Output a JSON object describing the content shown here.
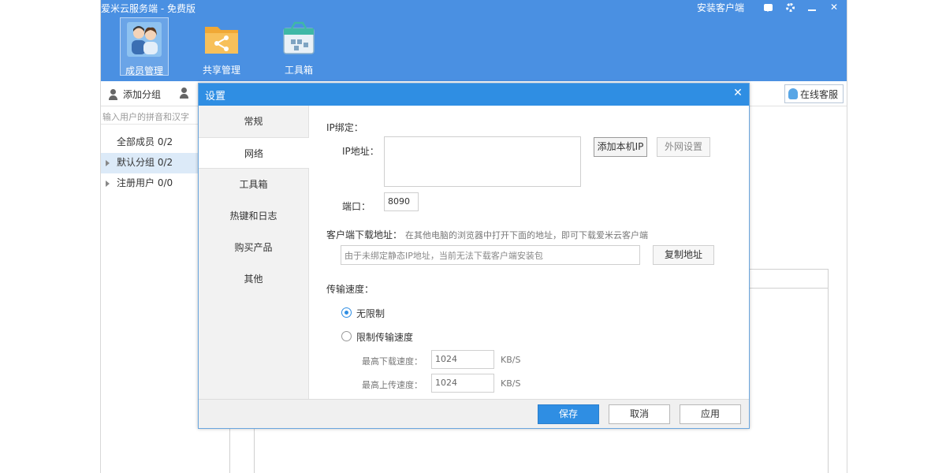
{
  "app": {
    "title": "爱米云服务端 - 免费版",
    "install_client": "安装客户端",
    "accent": "#4a90e2"
  },
  "nav": [
    {
      "label": "成员管理",
      "icon": "members-icon",
      "active": true
    },
    {
      "label": "共享管理",
      "icon": "share-folder-icon",
      "active": false
    },
    {
      "label": "工具箱",
      "icon": "toolbox-icon",
      "active": false
    }
  ],
  "toolbar": {
    "add_group": "添加分组",
    "online_service": "在线客服"
  },
  "sidebar": {
    "search_placeholder": "输入用户的拼音和汉字",
    "tree": [
      {
        "label": "全部成员 0/2"
      },
      {
        "label": "默认分组 0/2"
      },
      {
        "label": "注册用户 0/0"
      }
    ]
  },
  "dialog": {
    "title": "设置",
    "tabs": [
      "常规",
      "网络",
      "工具箱",
      "热键和日志",
      "购买产品",
      "其他"
    ],
    "active_tab": "网络",
    "ip_binding_label": "IP绑定：",
    "ip_address_label": "IP地址：",
    "ip_address_value": "",
    "add_local_ip": "添加本机IP",
    "external_settings": "外网设置",
    "port_label": "端口：",
    "port_value": "8090",
    "download_url_label": "客户端下载地址：",
    "download_url_hint": "在其他电脑的浏览器中打开下面的地址，即可下载爱米云客户端",
    "download_url_value": "由于未绑定静态IP地址，当前无法下载客户端安装包",
    "copy_address": "复制地址",
    "speed_label": "传输速度：",
    "unlimited": "无限制",
    "limit_speed": "限制传输速度",
    "max_download_label": "最高下载速度：",
    "max_download_value": "1024",
    "max_upload_label": "最高上传速度：",
    "max_upload_value": "1024",
    "unit": "KB/S",
    "save": "保存",
    "cancel": "取消",
    "apply": "应用"
  }
}
